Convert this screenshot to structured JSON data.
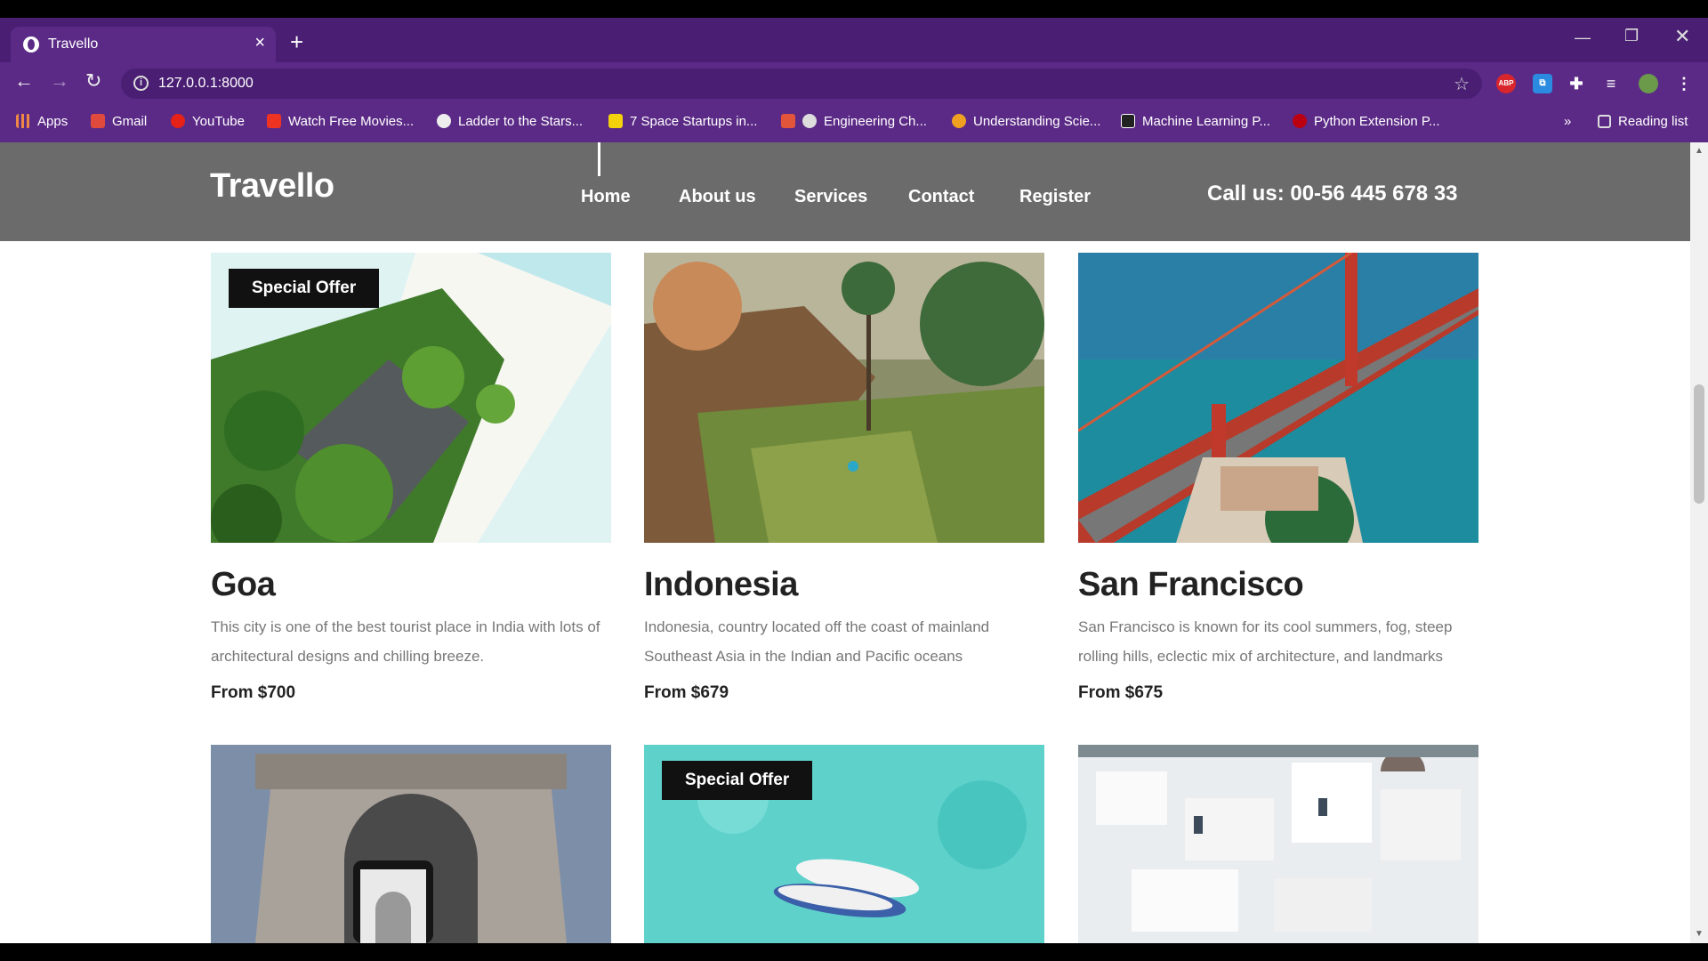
{
  "browser": {
    "tab_title": "Travello",
    "new_tab": "+",
    "url": "127.0.0.1:8000",
    "bookmarks": [
      "Apps",
      "Gmail",
      "YouTube",
      "Watch Free Movies...",
      "Ladder to the Stars...",
      "7 Space Startups in...",
      "Engineering Ch...",
      "Understanding Scie...",
      "Machine Learning P...",
      "Python Extension P..."
    ],
    "more_bookmarks": "»",
    "reading_list": "Reading list"
  },
  "site": {
    "logo": "Travello",
    "nav": [
      "Home",
      "About us",
      "Services",
      "Contact",
      "Register"
    ],
    "call": "Call us: 00-56 445 678 33",
    "badge_label": "Special Offer"
  },
  "destinations": [
    {
      "name": "Goa",
      "desc": "This city is one of the best tourist place in India with lots of architectural designs and chilling breeze.",
      "price": "From $700",
      "offer": true
    },
    {
      "name": "Indonesia",
      "desc": "Indonesia, country located off the coast of mainland Southeast Asia in the Indian and Pacific oceans",
      "price": "From $679",
      "offer": false
    },
    {
      "name": "San Francisco",
      "desc": "San Francisco is known for its cool summers, fog, steep rolling hills, eclectic mix of architecture, and landmarks",
      "price": "From $675",
      "offer": false
    },
    {
      "offer": false
    },
    {
      "offer": true
    },
    {
      "offer": false
    }
  ],
  "colors": {
    "chrome": "#5b2a86",
    "tabstrip": "#4a1f73",
    "header": "#6b6b6b",
    "badge": "#111111"
  }
}
